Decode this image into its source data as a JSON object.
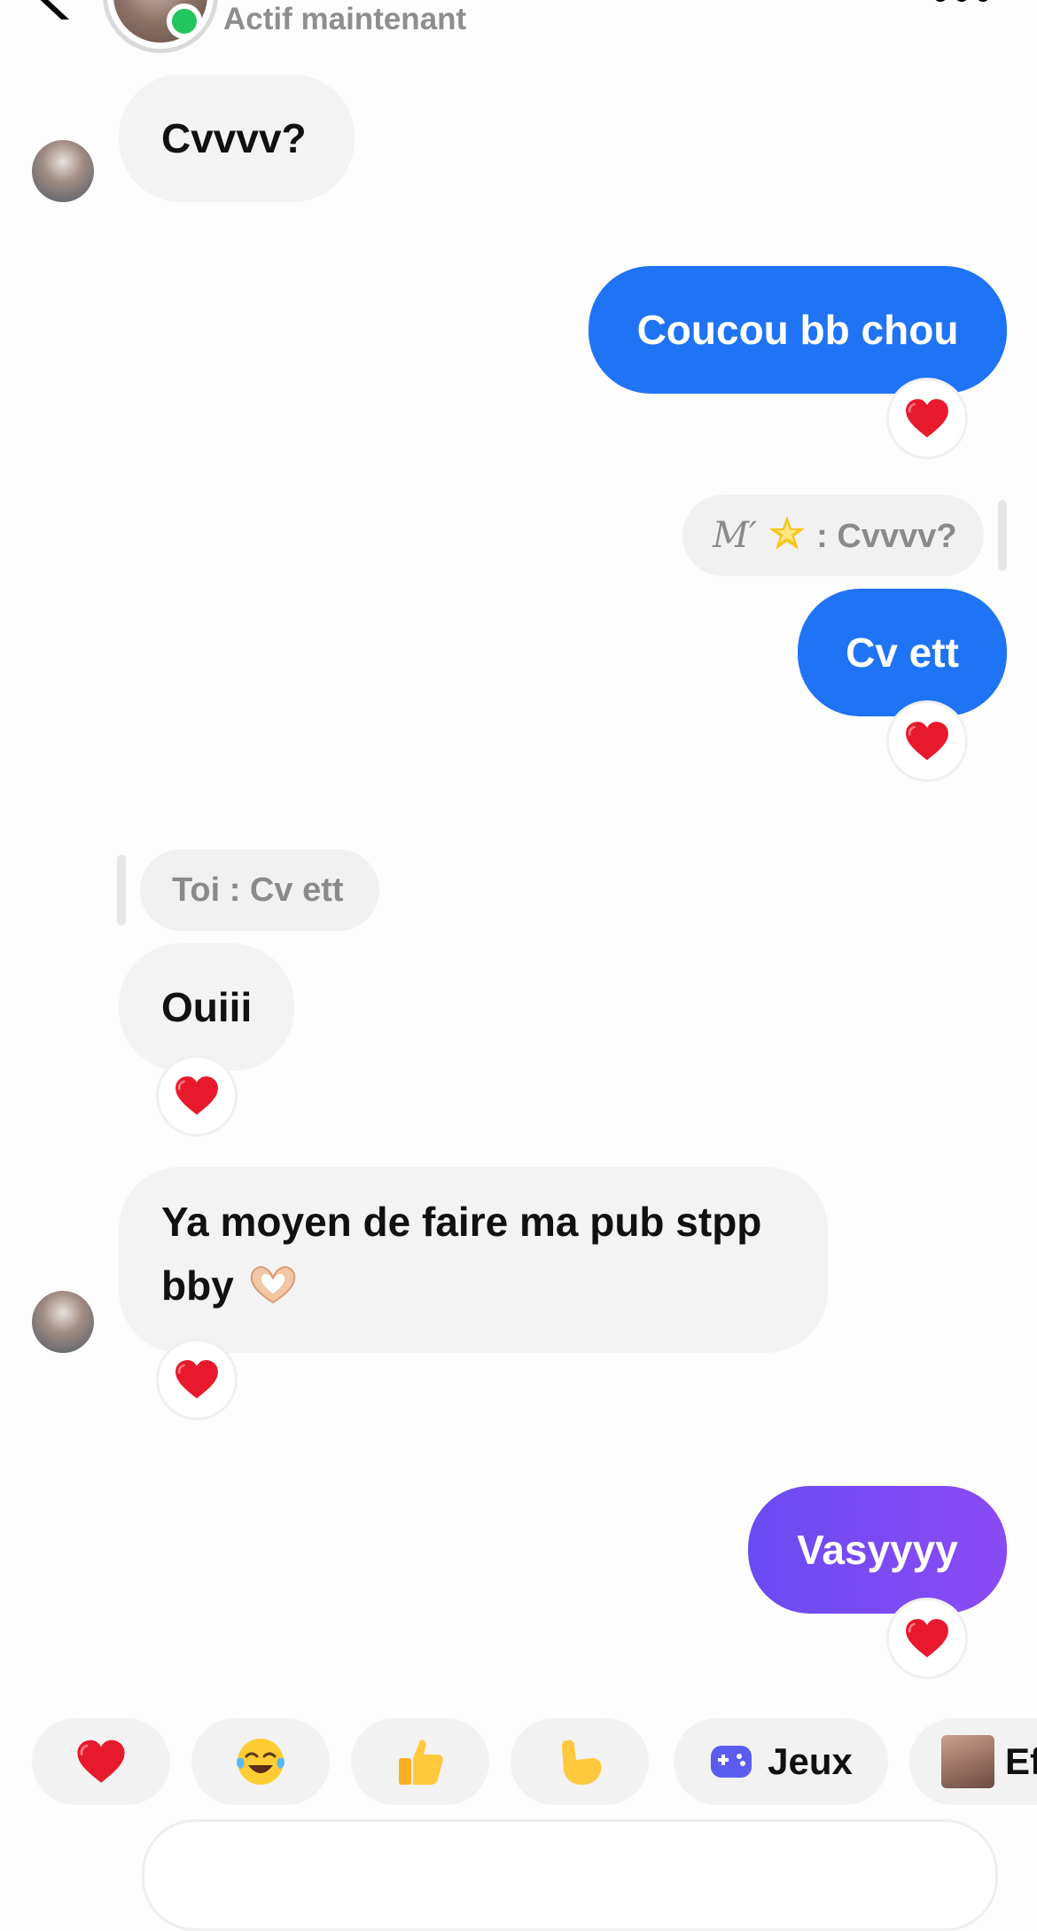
{
  "header": {
    "status": "Actif maintenant"
  },
  "messages": [
    {
      "id": "m1",
      "direction": "in",
      "text": "Cvvvv?"
    },
    {
      "id": "m2",
      "direction": "out",
      "text": "Coucou bb chou",
      "reaction": "heart"
    },
    {
      "id": "m3",
      "direction": "out",
      "reply_to": {
        "name": "M′",
        "icon": "glowing-star",
        "text": ": Cvvvv?"
      },
      "text": "Cv ett",
      "reaction": "heart"
    },
    {
      "id": "m4",
      "direction": "in",
      "reply_to": {
        "text": "Toi : Cv ett"
      },
      "text": "Ouiii",
      "reaction": "heart"
    },
    {
      "id": "m5",
      "direction": "in",
      "text_line1": "Ya moyen de faire ma pub stpp",
      "text_line2": "bby",
      "emoji": "heart-hands",
      "reaction": "heart"
    },
    {
      "id": "m6",
      "direction": "out",
      "text": "Vasyyyy",
      "reaction": "heart"
    }
  ],
  "quick_replies": [
    {
      "icon": "heart"
    },
    {
      "icon": "tears-of-joy"
    },
    {
      "icon": "thumbs-up"
    },
    {
      "icon": "pointing-hand"
    },
    {
      "icon": "gamepad",
      "label": "Jeux"
    },
    {
      "icon": "effect-thumbnail",
      "label": "Ef"
    }
  ],
  "colors": {
    "outgoing_blue": "#1f73f5",
    "outgoing_purple": "#7a4bf3",
    "incoming_gray": "#f3f3f3",
    "online_green": "#22c55e",
    "heart_red": "#e8192c"
  }
}
